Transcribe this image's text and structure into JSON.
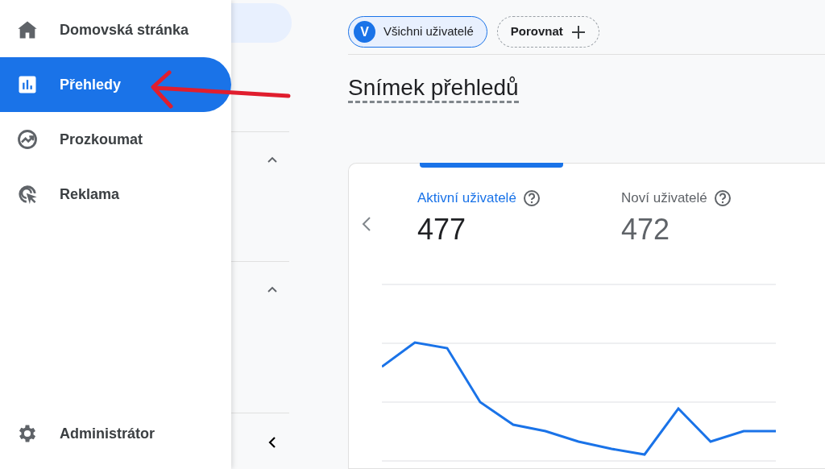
{
  "nav": {
    "items": [
      {
        "label": "Domovská stránka",
        "selected": false
      },
      {
        "label": "Přehledy",
        "selected": true
      },
      {
        "label": "Prozkoumat",
        "selected": false
      },
      {
        "label": "Reklama",
        "selected": false
      }
    ],
    "footer": {
      "label": "Administrátor"
    }
  },
  "toolbar": {
    "segments": [
      {
        "kind": "segment",
        "avatar": "V",
        "label": "Všichni uživatelé"
      },
      {
        "kind": "compare",
        "label": "Porovnat"
      }
    ]
  },
  "title": "Snímek přehledů",
  "card": {
    "metrics": [
      {
        "label": "Aktivní uživatelé",
        "value": "477",
        "selected": true
      },
      {
        "label": "Noví uživatelé",
        "value": "472",
        "selected": false
      }
    ]
  }
}
